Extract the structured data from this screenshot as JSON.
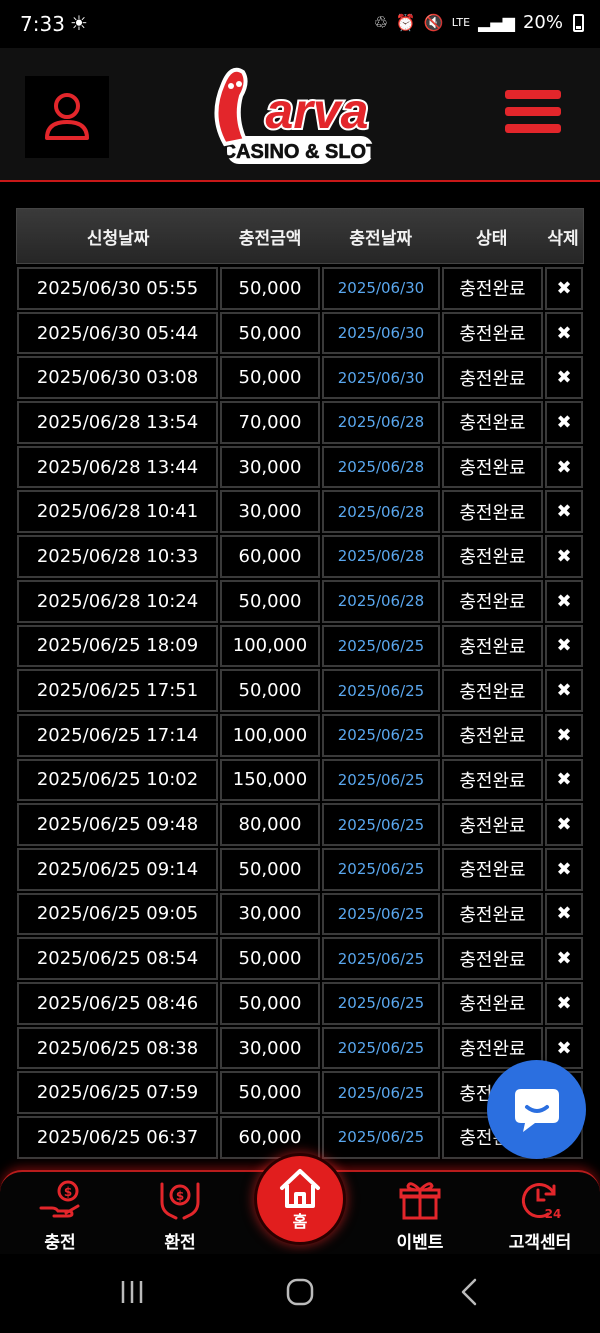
{
  "status_bar": {
    "time": "7:33",
    "network": "LTE",
    "battery": "20%"
  },
  "header": {
    "logo_text": "Larva",
    "logo_subtext": "CASINO & SLOT",
    "colors": {
      "accent": "#e3262b",
      "background": "#111111"
    }
  },
  "table": {
    "headers": [
      "신청날짜",
      "충전금액",
      "충전날짜",
      "상태",
      "삭제"
    ],
    "delete_symbol": "✖",
    "rows": [
      {
        "request": "2025/06/30 05:55",
        "amount": "50,000",
        "date": "2025/06/30",
        "status": "충전완료"
      },
      {
        "request": "2025/06/30 05:44",
        "amount": "50,000",
        "date": "2025/06/30",
        "status": "충전완료"
      },
      {
        "request": "2025/06/30 03:08",
        "amount": "50,000",
        "date": "2025/06/30",
        "status": "충전완료"
      },
      {
        "request": "2025/06/28 13:54",
        "amount": "70,000",
        "date": "2025/06/28",
        "status": "충전완료"
      },
      {
        "request": "2025/06/28 13:44",
        "amount": "30,000",
        "date": "2025/06/28",
        "status": "충전완료"
      },
      {
        "request": "2025/06/28 10:41",
        "amount": "30,000",
        "date": "2025/06/28",
        "status": "충전완료"
      },
      {
        "request": "2025/06/28 10:33",
        "amount": "60,000",
        "date": "2025/06/28",
        "status": "충전완료"
      },
      {
        "request": "2025/06/28 10:24",
        "amount": "50,000",
        "date": "2025/06/28",
        "status": "충전완료"
      },
      {
        "request": "2025/06/25 18:09",
        "amount": "100,000",
        "date": "2025/06/25",
        "status": "충전완료"
      },
      {
        "request": "2025/06/25 17:51",
        "amount": "50,000",
        "date": "2025/06/25",
        "status": "충전완료"
      },
      {
        "request": "2025/06/25 17:14",
        "amount": "100,000",
        "date": "2025/06/25",
        "status": "충전완료"
      },
      {
        "request": "2025/06/25 10:02",
        "amount": "150,000",
        "date": "2025/06/25",
        "status": "충전완료"
      },
      {
        "request": "2025/06/25 09:48",
        "amount": "80,000",
        "date": "2025/06/25",
        "status": "충전완료"
      },
      {
        "request": "2025/06/25 09:14",
        "amount": "50,000",
        "date": "2025/06/25",
        "status": "충전완료"
      },
      {
        "request": "2025/06/25 09:05",
        "amount": "30,000",
        "date": "2025/06/25",
        "status": "충전완료"
      },
      {
        "request": "2025/06/25 08:54",
        "amount": "50,000",
        "date": "2025/06/25",
        "status": "충전완료"
      },
      {
        "request": "2025/06/25 08:46",
        "amount": "50,000",
        "date": "2025/06/25",
        "status": "충전완료"
      },
      {
        "request": "2025/06/25 08:38",
        "amount": "30,000",
        "date": "2025/06/25",
        "status": "충전완료"
      },
      {
        "request": "2025/06/25 07:59",
        "amount": "50,000",
        "date": "2025/06/25",
        "status": "충전완료"
      },
      {
        "request": "2025/06/25 06:37",
        "amount": "60,000",
        "date": "2025/06/25",
        "status": "충전완료"
      }
    ]
  },
  "bottom_nav": {
    "items": [
      {
        "label": "충전",
        "icon": "hand-coin-icon"
      },
      {
        "label": "환전",
        "icon": "exchange-hands-icon"
      },
      {
        "label": "홈",
        "icon": "home-icon"
      },
      {
        "label": "이벤트",
        "icon": "gift-icon"
      },
      {
        "label": "고객센터",
        "icon": "support-24-icon"
      }
    ]
  },
  "chat": {
    "icon": "chat-bubble-icon",
    "color": "#2b6fe0"
  }
}
